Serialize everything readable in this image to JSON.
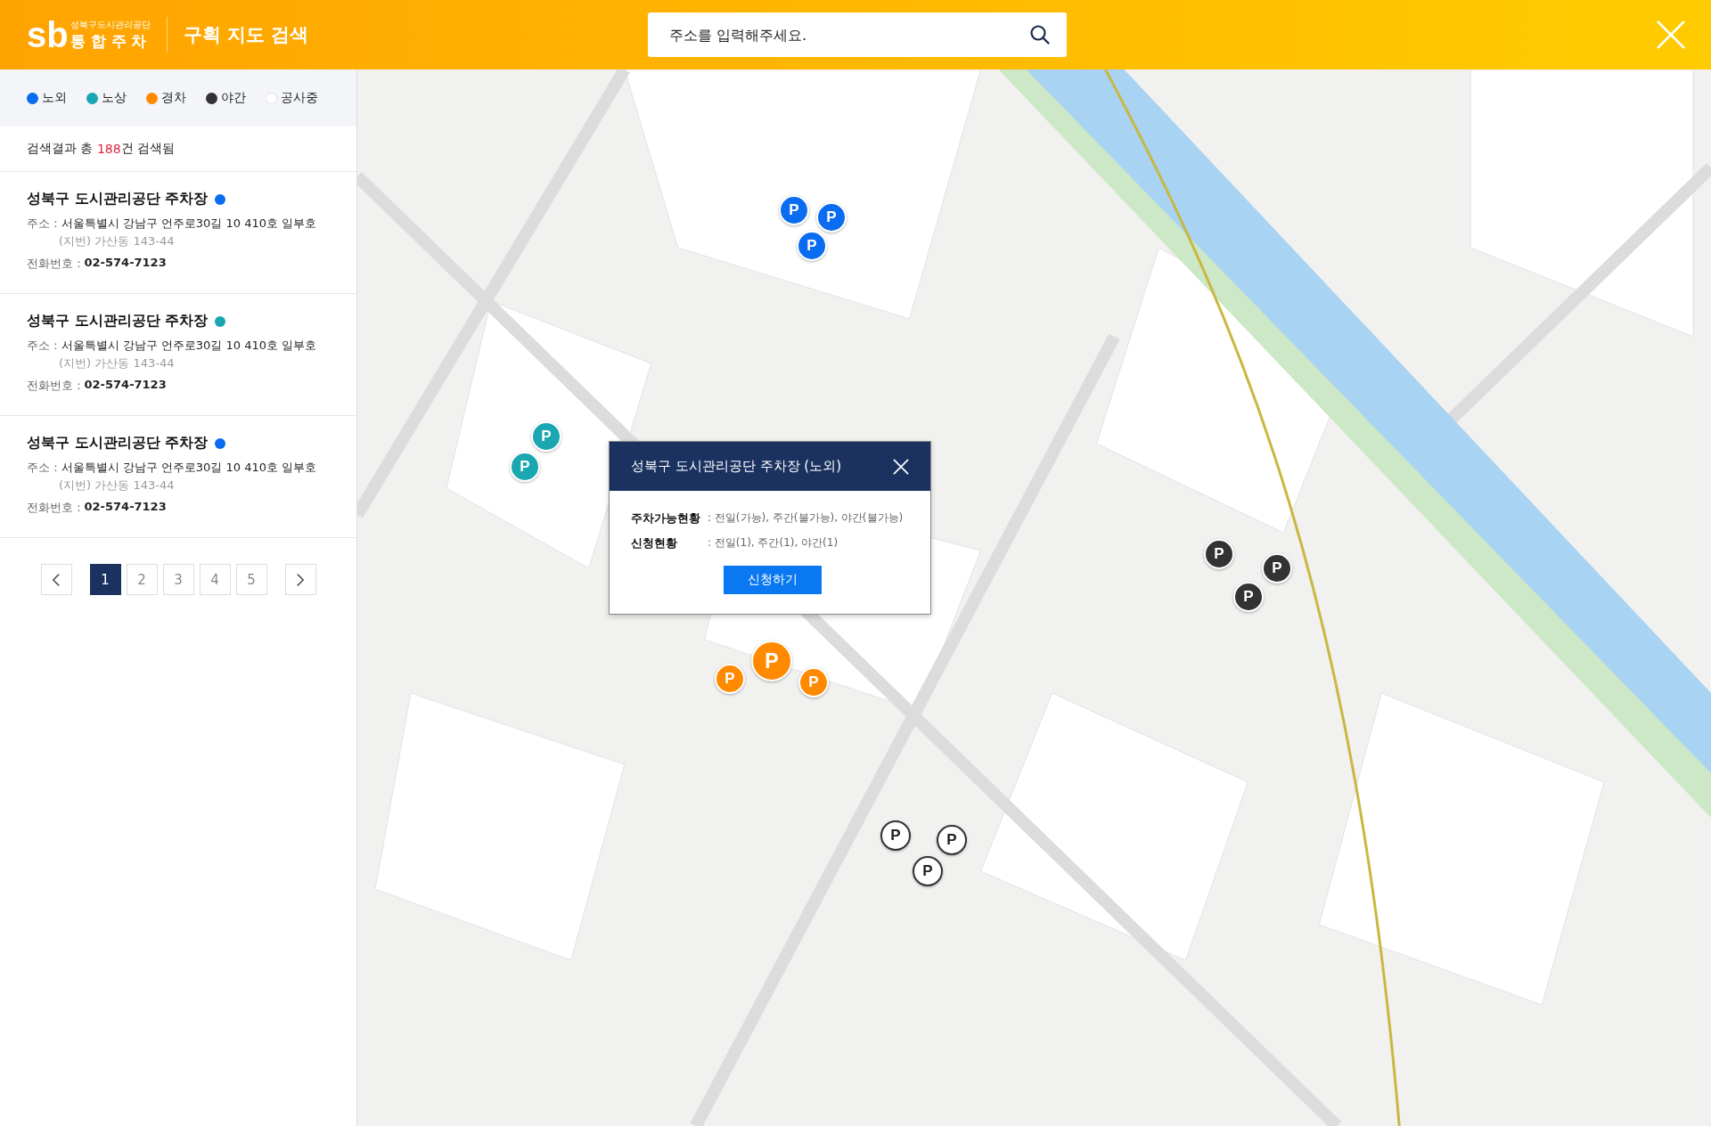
{
  "header": {
    "logo": {
      "mark": "sb",
      "org": "성북구도시관리공단",
      "service": "통 합 주 차"
    },
    "title": "구획 지도 검색",
    "search": {
      "placeholder": "주소를 입력해주세요."
    }
  },
  "legend": [
    {
      "label": "노외",
      "color": "#0a6cf0"
    },
    {
      "label": "노상",
      "color": "#1aa7b2"
    },
    {
      "label": "경차",
      "color": "#ff8a00"
    },
    {
      "label": "야간",
      "color": "#333333"
    },
    {
      "label": "공사중",
      "color": "#ffffff"
    }
  ],
  "result_summary": {
    "prefix": "검색결과 총 ",
    "count": "188",
    "suffix": "건 검색됨"
  },
  "results": [
    {
      "name": "성북구 도시관리공단 주차장",
      "color": "#0a6cf0",
      "address_label": "주소 :",
      "address": "서울특별시 강남구 언주로30길 10 410호 일부호",
      "lot": "(지번) 가산동 143-44",
      "phone_label": "전화번호 :",
      "phone": "02-574-7123"
    },
    {
      "name": "성북구 도시관리공단 주차장",
      "color": "#1aa7b2",
      "address_label": "주소 :",
      "address": "서울특별시 강남구 언주로30길 10 410호 일부호",
      "lot": "(지번) 가산동 143-44",
      "phone_label": "전화번호 :",
      "phone": "02-574-7123"
    },
    {
      "name": "성북구 도시관리공단 주차장",
      "color": "#0a6cf0",
      "address_label": "주소 :",
      "address": "서울특별시 강남구 언주로30길 10 410호 일부호",
      "lot": "(지번) 가산동 143-44",
      "phone_label": "전화번호 :",
      "phone": "02-574-7123"
    }
  ],
  "pagination": {
    "pages": [
      {
        "label": "1",
        "selected": true
      },
      {
        "label": "2",
        "selected": false
      },
      {
        "label": "3",
        "selected": false
      },
      {
        "label": "4",
        "selected": false
      },
      {
        "label": "5",
        "selected": false
      }
    ]
  },
  "popup": {
    "title": "성북구 도시관리공단 주차장 (노외)",
    "rows": [
      {
        "label": "주차가능현황",
        "value": ": 전일(가능), 주간(불가능), 야간(불가능)"
      },
      {
        "label": "신청현황",
        "value": ": 전일(1), 주간(1), 야간(1)"
      }
    ],
    "button": "신청하기"
  },
  "markers": [
    {
      "label": "P",
      "color": "#0a6cf0"
    },
    {
      "label": "P",
      "color": "#0a6cf0"
    },
    {
      "label": "P",
      "color": "#0a6cf0"
    },
    {
      "label": "P",
      "color": "#1aa7b2"
    },
    {
      "label": "P",
      "color": "#1aa7b2"
    },
    {
      "label": "P",
      "color": "#ff8a00"
    },
    {
      "label": "P",
      "color": "#ff8a00"
    },
    {
      "label": "P",
      "color": "#ff8a00"
    },
    {
      "label": "P",
      "color": "#333333"
    },
    {
      "label": "P",
      "color": "#333333"
    },
    {
      "label": "P",
      "color": "#333333"
    },
    {
      "label": "P",
      "color": "#ffffff"
    },
    {
      "label": "P",
      "color": "#ffffff"
    },
    {
      "label": "P",
      "color": "#ffffff"
    }
  ]
}
